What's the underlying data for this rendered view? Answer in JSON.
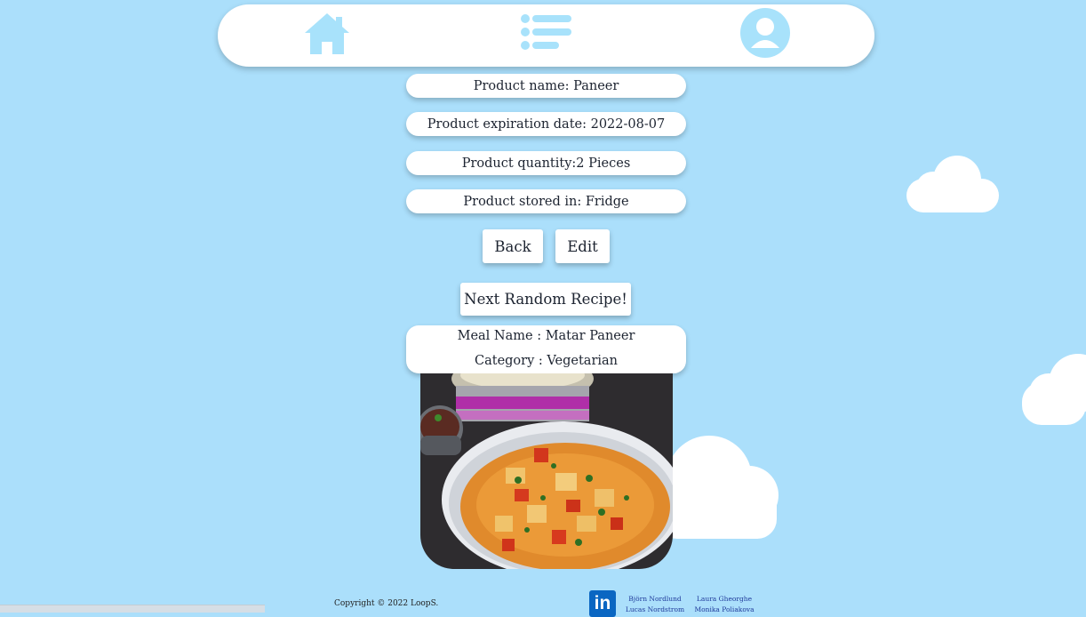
{
  "nav": {
    "home_icon": "home-icon",
    "list_icon": "list-icon",
    "profile_icon": "user-profile-icon",
    "icon_color": "#a8e2fb"
  },
  "product": {
    "name": "Product name: Paneer",
    "expiration": "Product expiration date: 2022-08-07",
    "quantity": "Product quantity:2 Pieces",
    "stored": "Product stored in: Fridge"
  },
  "buttons": {
    "back": "Back",
    "edit": "Edit",
    "next_recipe": "Next Random Recipe!"
  },
  "meal": {
    "name": "Meal Name : Matar Paneer",
    "category": "Category : Vegetarian"
  },
  "footer": {
    "copyright": "Copyright © 2022 LoopS.",
    "linkedin_icon": "linkedin-icon",
    "linkedin_text": "in",
    "authors": [
      {
        "name": "Björn Nordlund",
        "sub": "Lucas Nordstrom"
      },
      {
        "name": "Laura Gheorghe",
        "sub": "Monika Poliakova"
      }
    ]
  },
  "colors": {
    "background": "#abdffb",
    "card": "#ffffff",
    "brand_linkedin": "#0a66c2"
  }
}
